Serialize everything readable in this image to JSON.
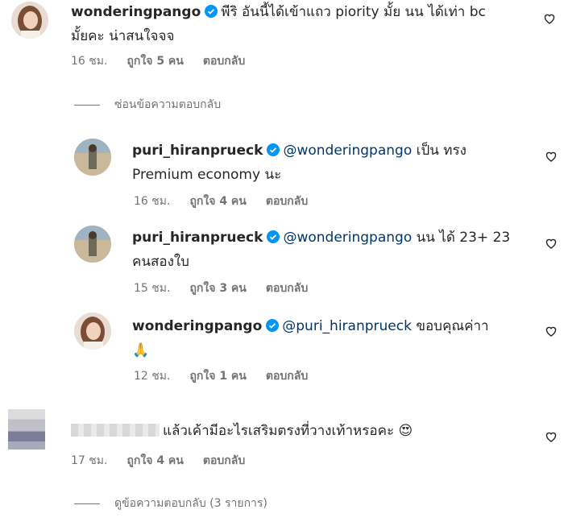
{
  "comments": [
    {
      "username": "wonderingpango",
      "text_line1": "พีริ อันนี้ได้เข้าแถว piority มั้ย นน ได้เท่า bc",
      "text_line2": "มั้ยคะ น่าสนใจจจ",
      "time": "16 ชม.",
      "likes": "ถูกใจ 5 คน",
      "reply": "ตอบกลับ"
    }
  ],
  "hide_replies": "ซ่อนข้อความตอบกลับ",
  "replies": [
    {
      "username": "puri_hiranprueck",
      "mention": "@wonderingpango",
      "text_line1": " เป็น ทรง",
      "text_line2": "Premium economy นะ",
      "time": "16 ชม.",
      "likes": "ถูกใจ 4 คน",
      "reply": "ตอบกลับ"
    },
    {
      "username": "puri_hiranprueck",
      "mention": "@wonderingpango",
      "text_line1": " นน ได้ 23+ 23",
      "text_line2": "คนสองใบ",
      "time": "15 ชม.",
      "likes": "ถูกใจ 3 คน",
      "reply": "ตอบกลับ"
    },
    {
      "username": "wonderingpango",
      "mention": "@puri_hiranprueck",
      "text_line1": " ขอบคุณค่าา",
      "text_line2": "🙏",
      "time": "12 ชม.",
      "likes": "ถูกใจ 1 คน",
      "reply": "ตอบกลับ"
    }
  ],
  "anon_comment": {
    "text": "แล้วเค้ามีอะไรเสริมตรงที่วางเท้าหรอคะ 😍",
    "time": "17 ชม.",
    "likes": "ถูกใจ 4 คน",
    "reply": "ตอบกลับ"
  },
  "view_replies": "ดูข้อความตอบกลับ (3 รายการ)",
  "colors": {
    "verified": "#0095f6",
    "mention": "#00376b",
    "meta": "#737373"
  }
}
